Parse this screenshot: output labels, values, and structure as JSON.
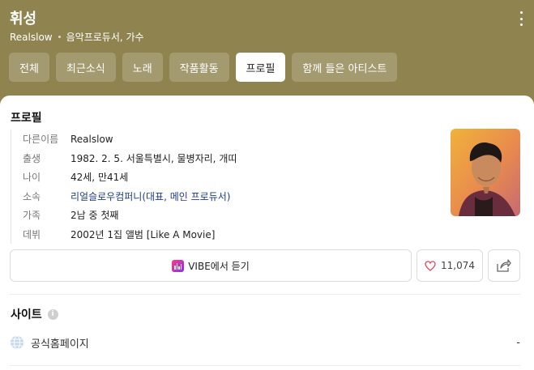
{
  "header": {
    "name": "휘성",
    "alias": "Realslow",
    "roles": "음악프로듀서, 가수",
    "more_icon": "kebab-vertical-icon",
    "background_color": "#8f8450"
  },
  "tabs": [
    {
      "label": "전체",
      "active": false
    },
    {
      "label": "최근소식",
      "active": false
    },
    {
      "label": "노래",
      "active": false
    },
    {
      "label": "작품활동",
      "active": false
    },
    {
      "label": "프로필",
      "active": true
    },
    {
      "label": "함께 들은 아티스트",
      "active": false
    }
  ],
  "profile": {
    "title": "프로필",
    "rows": [
      {
        "key": "다른이름",
        "value": "Realslow"
      },
      {
        "key": "출생",
        "value": "1982. 2. 5. 서울특별시, 물병자리, 개띠"
      },
      {
        "key": "나이",
        "value": "42세, 만41세"
      },
      {
        "key": "소속",
        "value": "리얼슬로우컴퍼니(대표, 메인 프로듀서)"
      },
      {
        "key": "가족",
        "value": "2남 중 첫째"
      },
      {
        "key": "데뷔",
        "value": "2002년 1집 앨범 [Like A Movie]"
      }
    ],
    "photo_icon": "artist-photo"
  },
  "actions": {
    "vibe_label": "VIBE에서 듣기",
    "like_count": "11,074",
    "vibe_icon": "vibe-logo-icon",
    "like_icon": "heart-icon",
    "share_icon": "share-icon"
  },
  "site": {
    "title": "사이트",
    "info_icon": "info-icon",
    "official_label": "공식홈페이지",
    "official_value": "-",
    "globe_icon": "globe-icon"
  },
  "colors": {
    "header_bg": "#8f8450",
    "link": "#1f3d82",
    "heart": "#e0435c"
  }
}
